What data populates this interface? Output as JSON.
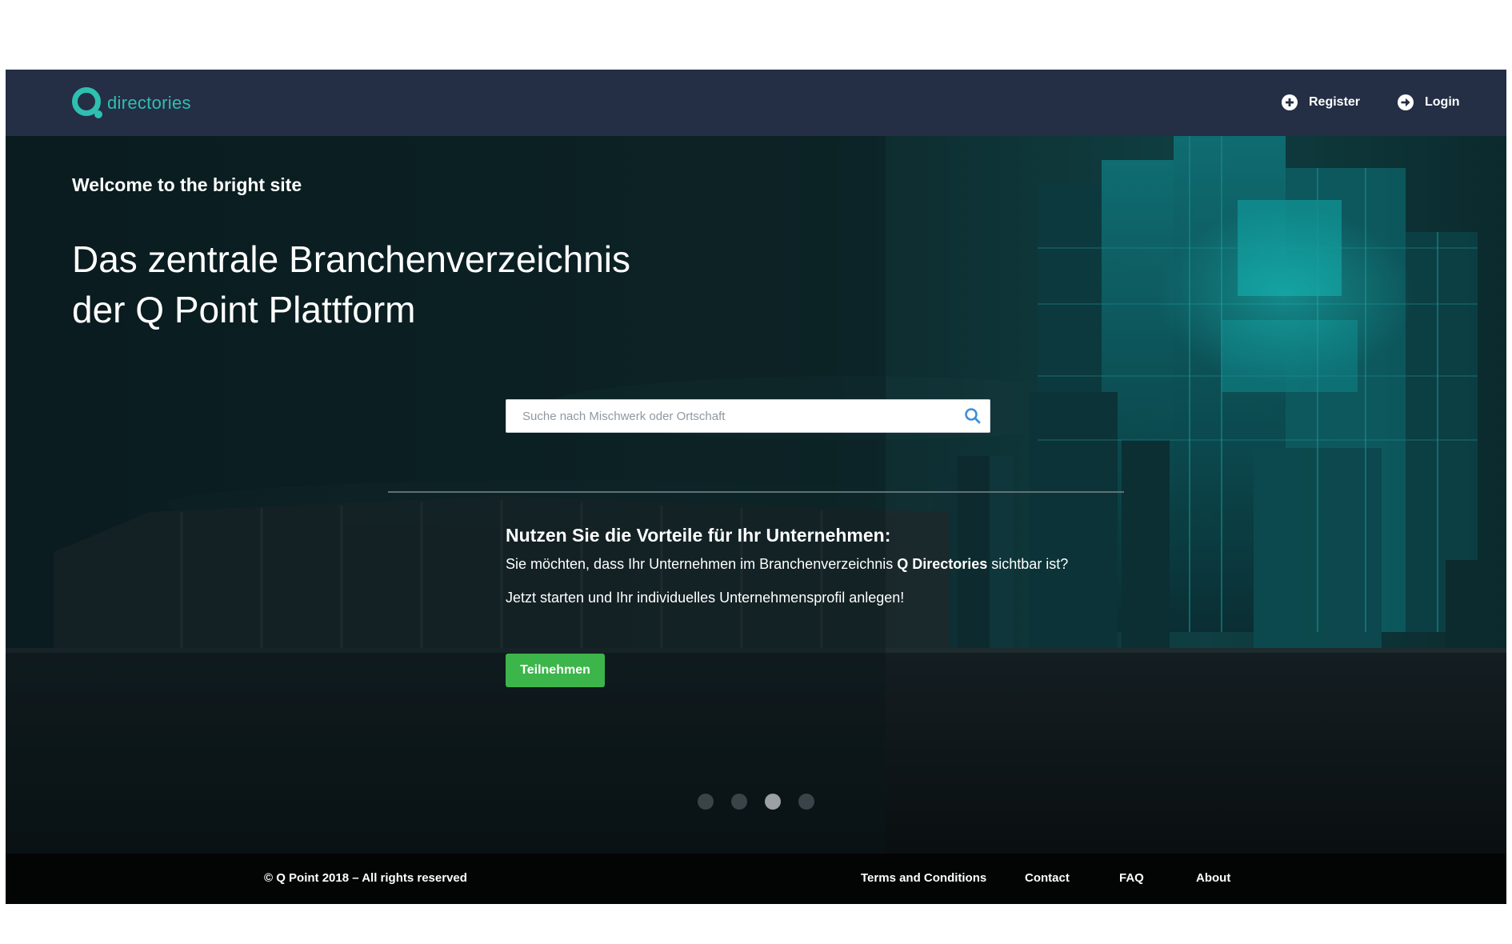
{
  "header": {
    "logo_text": "directories",
    "nav": {
      "register_label": "Register",
      "login_label": "Login"
    },
    "icons": {
      "register": "plus-circle-icon",
      "login": "arrow-right-circle-icon"
    }
  },
  "hero": {
    "welcome": "Welcome to the bright site",
    "headline_line_1": "Das zentrale Branchenverzeichnis",
    "headline_line_2": "der Q Point Plattform",
    "search": {
      "placeholder": "Suche nach Mischwerk oder Ortschaft",
      "value": "",
      "icon": "search-icon"
    },
    "promo": {
      "heading": "Nutzen Sie die Vorteile für Ihr Unternehmen:",
      "line_1_prefix": "Sie möchten, dass Ihr Unternehmen im Branchenverzeichnis ",
      "line_1_bold": "Q Directories",
      "line_1_suffix": " sichtbar ist?",
      "line_2": "Jetzt starten und Ihr individuelles Unternehmensprofil anlegen!",
      "button_label": "Teilnehmen"
    },
    "carousel": {
      "slide_count": 4,
      "active_index": 2
    }
  },
  "footer": {
    "copyright": "© Q Point 2018 – All rights reserved",
    "links": {
      "terms": "Terms and Conditions",
      "contact": "Contact",
      "faq": "FAQ",
      "about": "About"
    }
  },
  "colors": {
    "header_bg": "#242e44",
    "brand_teal": "#2fbfb0",
    "cta_green": "#3cb54a",
    "footer_bg": "#030404",
    "hero_dark": "#0b1c1f",
    "search_icon": "#3f8fd8"
  }
}
